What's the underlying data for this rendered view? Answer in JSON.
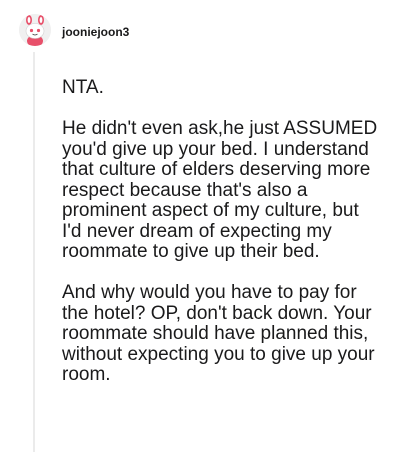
{
  "comment": {
    "username": "jooniejoon3",
    "avatar_icon": "snoo-avatar-icon",
    "paragraphs": [
      "NTA.",
      "He didn't even ask,he just ASSUMED you'd give up your bed. I understand that culture of elders deserving more respect because that's also a prominent aspect of my culture, but I'd never dream of expecting my roommate to give up their bed.",
      "And why would you have to pay for the hotel? OP, don't back down. Your roommate should have planned this, without expecting you to give up your room."
    ]
  },
  "colors": {
    "text": "#1a1a1b",
    "thread_line": "#ebebeb",
    "avatar_accent": "#e8506a"
  }
}
